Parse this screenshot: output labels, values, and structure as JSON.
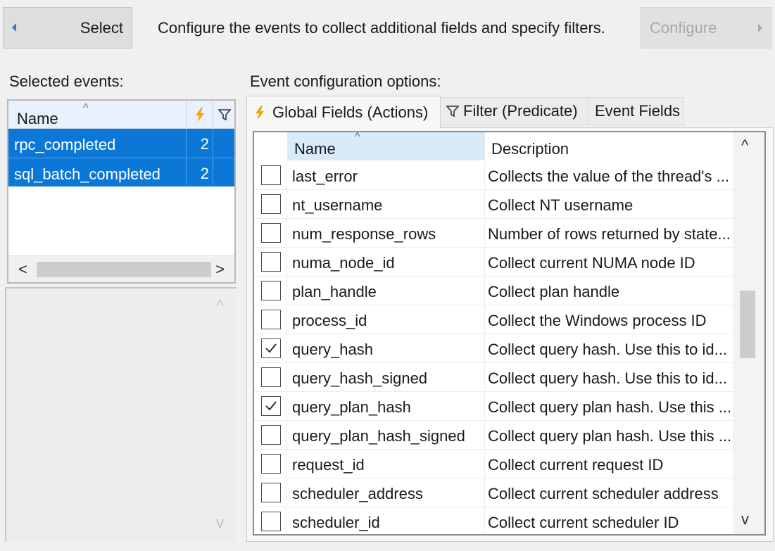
{
  "toolbar": {
    "select_label": "Select",
    "instruction": "Configure the events to collect additional fields and specify filters.",
    "configure_label": "Configure"
  },
  "left": {
    "selected_events_label": "Selected events:",
    "grid": {
      "name_header": "Name",
      "rows": [
        {
          "name": "rpc_completed",
          "actions_count": "2"
        },
        {
          "name": "sql_batch_completed",
          "actions_count": "2"
        }
      ]
    }
  },
  "right": {
    "options_label": "Event configuration options:",
    "tabs": [
      {
        "label": "Global Fields (Actions)",
        "icon": "lightning-icon",
        "selected": true
      },
      {
        "label": "Filter (Predicate)",
        "icon": "filter-icon",
        "selected": false
      },
      {
        "label": "Event Fields",
        "icon": "",
        "selected": false
      }
    ],
    "fields_grid": {
      "name_header": "Name",
      "description_header": "Description",
      "scroll_position": 0.47,
      "rows": [
        {
          "name": "last_error",
          "description": "Collects the value of the thread's ...",
          "checked": false
        },
        {
          "name": "nt_username",
          "description": "Collect NT username",
          "checked": false
        },
        {
          "name": "num_response_rows",
          "description": "Number of rows returned by state...",
          "checked": false
        },
        {
          "name": "numa_node_id",
          "description": "Collect current NUMA node ID",
          "checked": false
        },
        {
          "name": "plan_handle",
          "description": "Collect plan handle",
          "checked": false
        },
        {
          "name": "process_id",
          "description": "Collect the Windows process ID",
          "checked": false
        },
        {
          "name": "query_hash",
          "description": "Collect query hash. Use this to id...",
          "checked": true
        },
        {
          "name": "query_hash_signed",
          "description": "Collect query hash. Use this to id...",
          "checked": false
        },
        {
          "name": "query_plan_hash",
          "description": "Collect query plan hash. Use this ...",
          "checked": true
        },
        {
          "name": "query_plan_hash_signed",
          "description": "Collect query plan hash. Use this ...",
          "checked": false
        },
        {
          "name": "request_id",
          "description": "Collect current request ID",
          "checked": false
        },
        {
          "name": "scheduler_address",
          "description": "Collect current scheduler address",
          "checked": false
        },
        {
          "name": "scheduler_id",
          "description": "Collect current scheduler ID",
          "checked": false
        }
      ]
    }
  },
  "colors": {
    "selection": "#0b78d7",
    "header_sorted": "#d9ebfb",
    "lightning": "#f0a500"
  }
}
